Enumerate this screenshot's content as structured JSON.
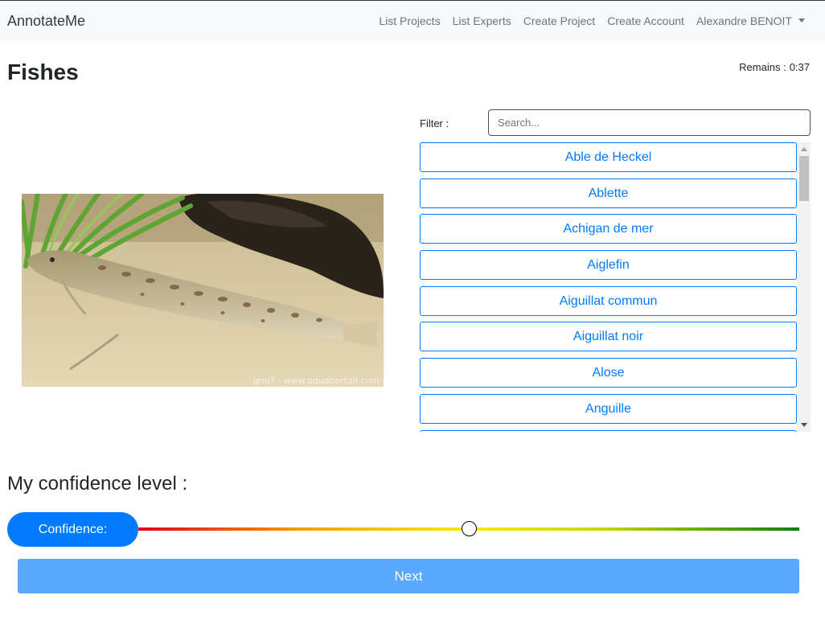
{
  "navbar": {
    "brand": "AnnotateMe",
    "links": [
      "List Projects",
      "List Experts",
      "Create Project",
      "Create Account"
    ],
    "user": "Alexandre BENOIT"
  },
  "page": {
    "title": "Fishes",
    "remains_label": "Remains :",
    "remains_value": "0:37"
  },
  "image": {
    "watermark": "gnu? - www.aquaportail.com"
  },
  "filter": {
    "label": "Filter :",
    "placeholder": "Search..."
  },
  "species": [
    "Able de Heckel",
    "Ablette",
    "Achigan de mer",
    "Aiglefin",
    "Aiguillat commun",
    "Aiguillat noir",
    "Alose",
    "Anguille"
  ],
  "confidence": {
    "heading": "My confidence level :",
    "label": "Confidence:",
    "value": 0.5
  },
  "actions": {
    "next": "Next"
  },
  "colors": {
    "primary": "#007bff",
    "next_button": "#58a9ff"
  }
}
